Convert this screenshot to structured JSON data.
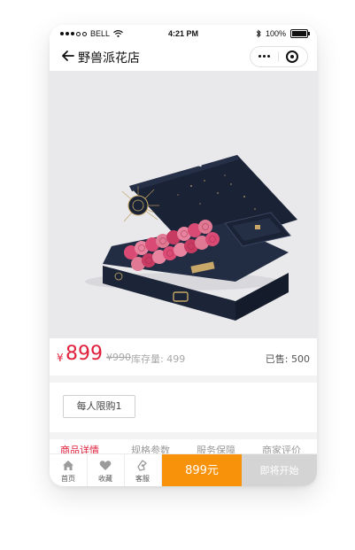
{
  "status_bar": {
    "carrier": "BELL",
    "time": "4:21 PM",
    "battery": "100%"
  },
  "navbar": {
    "title": "野兽派花店",
    "back_icon": "arrow-left-icon",
    "more_icon": "more-dots-icon",
    "close_icon": "target-circle-icon"
  },
  "product": {
    "currency": "¥",
    "price": "899",
    "original_price": "¥990",
    "stock": "库存量: 499",
    "sold": "已售: 500"
  },
  "limit": {
    "label": "每人限购1"
  },
  "tabs": [
    {
      "label": "商品详情",
      "active": true
    },
    {
      "label": "规格参数",
      "active": false
    },
    {
      "label": "服务保障",
      "active": false
    },
    {
      "label": "商家评价",
      "active": false
    }
  ],
  "bottom_bar": {
    "home": "首页",
    "favorite": "收藏",
    "service": "客服",
    "buy": "899元",
    "coming_soon": "即将开始"
  },
  "colors": {
    "accent_red": "#e0203c",
    "buy_orange": "#f7920a",
    "disabled_gray": "#d4d4d4"
  }
}
